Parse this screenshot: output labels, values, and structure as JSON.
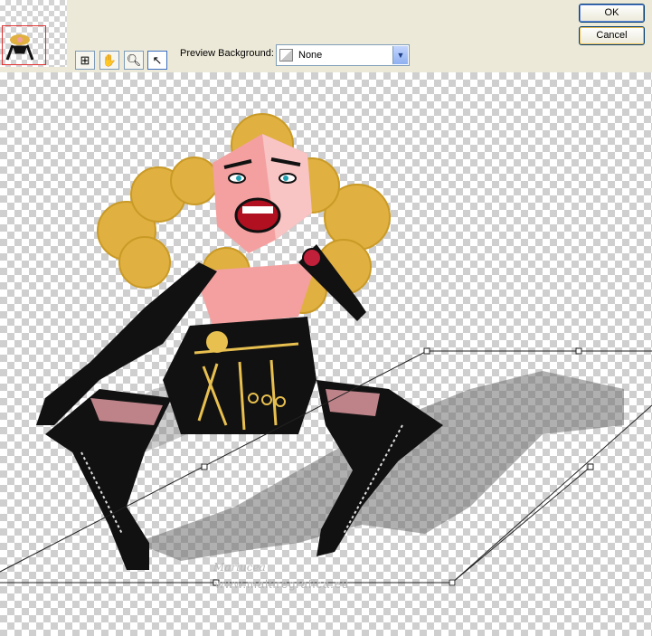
{
  "toolbar": {
    "preview_background_label": "Preview Background:",
    "preview_background_value": "None",
    "tools": [
      "zoom-fit-icon",
      "pan-hand-icon",
      "zoom-icon",
      "pointer-arrow-icon"
    ]
  },
  "buttons": {
    "ok": "OK",
    "cancel": "Cancel"
  },
  "canvas": {
    "watermark": "www.maltiregrafica.eu",
    "watermark_signature": "Mariucea"
  }
}
